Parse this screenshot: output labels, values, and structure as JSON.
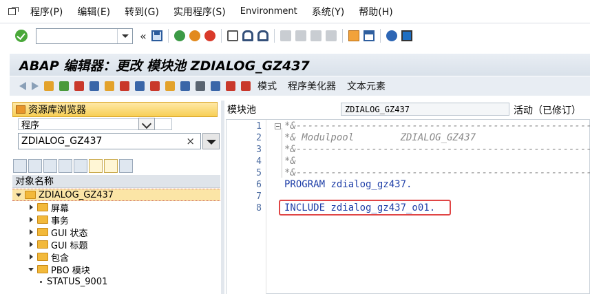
{
  "menubar": {
    "items": [
      "程序(P)",
      "编辑(E)",
      "转到(G)",
      "实用程序(S)",
      "Environment",
      "系统(Y)",
      "帮助(H)"
    ]
  },
  "std_toolbar": {
    "command_field": ""
  },
  "title": "ABAP 编辑器：更改 模块池 ZDIALOG_GZ437",
  "app_toolbar": {
    "buttons": [
      "模式",
      "程序美化器",
      "文本元素"
    ]
  },
  "navigator": {
    "header": "资源库浏览器",
    "object_type": "程序",
    "object_name": "ZDIALOG_GZ437",
    "clear_symbol": "×",
    "tree_header": "对象名称",
    "tree": [
      {
        "label": "ZDIALOG_GZ437",
        "level": 0,
        "state": "open",
        "selected": true
      },
      {
        "label": "屏幕",
        "level": 1,
        "state": "closed"
      },
      {
        "label": "事务",
        "level": 1,
        "state": "closed"
      },
      {
        "label": "GUI 状态",
        "level": 1,
        "state": "closed"
      },
      {
        "label": "GUI 标题",
        "level": 1,
        "state": "closed"
      },
      {
        "label": "包含",
        "level": 1,
        "state": "closed"
      },
      {
        "label": "PBO 模块",
        "level": 1,
        "state": "open"
      },
      {
        "label": "STATUS_9001",
        "level": 2,
        "state": "leaf"
      }
    ]
  },
  "editor": {
    "type_label": "模块池",
    "program_name": "ZDIALOG_GZ437",
    "status": "活动（已修订）",
    "lines": [
      {
        "num": "1",
        "text": "*&---------------------------------------------------------------------",
        "kind": "comment"
      },
      {
        "num": "2",
        "text": "*& Modulpool        ZDIALOG_GZ437",
        "kind": "comment"
      },
      {
        "num": "3",
        "text": "*&---------------------------------------------------------------------",
        "kind": "comment"
      },
      {
        "num": "4",
        "text": "*&",
        "kind": "comment"
      },
      {
        "num": "5",
        "text": "*&---------------------------------------------------------------------",
        "kind": "comment"
      },
      {
        "num": "6",
        "text": "PROGRAM zdialog_gz437.",
        "kind": "code"
      },
      {
        "num": "7",
        "text": "",
        "kind": "code"
      },
      {
        "num": "8",
        "text": "INCLUDE zdialog_gz437_o01.",
        "kind": "code"
      }
    ]
  }
}
